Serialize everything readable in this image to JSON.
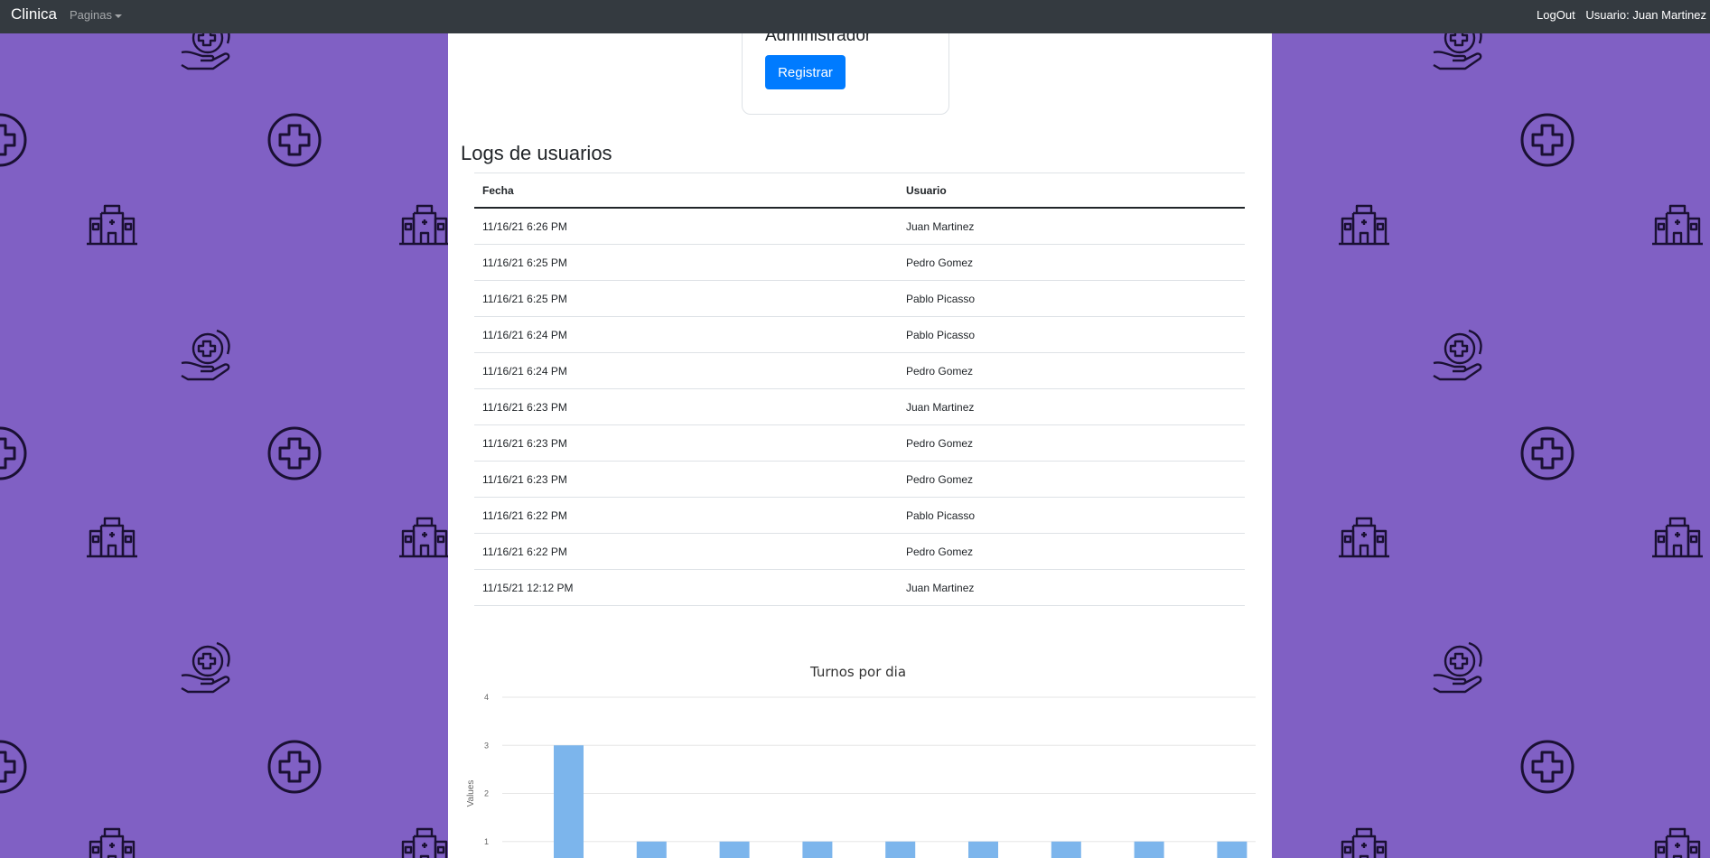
{
  "navbar": {
    "brand": "Clinica",
    "pages_menu": "Paginas",
    "logout": "LogOut",
    "user_label": "Usuario: Juan Martinez"
  },
  "admin_card": {
    "title": "Administrador",
    "register_button": "Registrar"
  },
  "logs": {
    "title": "Logs de usuarios",
    "columns": [
      "Fecha",
      "Usuario"
    ],
    "rows": [
      [
        "11/16/21 6:26 PM",
        "Juan Martinez"
      ],
      [
        "11/16/21 6:25 PM",
        "Pedro Gomez"
      ],
      [
        "11/16/21 6:25 PM",
        "Pablo Picasso"
      ],
      [
        "11/16/21 6:24 PM",
        "Pablo Picasso"
      ],
      [
        "11/16/21 6:24 PM",
        "Pedro Gomez"
      ],
      [
        "11/16/21 6:23 PM",
        "Juan Martinez"
      ],
      [
        "11/16/21 6:23 PM",
        "Pedro Gomez"
      ],
      [
        "11/16/21 6:23 PM",
        "Pedro Gomez"
      ],
      [
        "11/16/21 6:22 PM",
        "Pablo Picasso"
      ],
      [
        "11/16/21 6:22 PM",
        "Pedro Gomez"
      ],
      [
        "11/15/21 12:12 PM",
        "Juan Martinez"
      ]
    ]
  },
  "colors": {
    "page_background": "#8060c4",
    "navbar": "#343a40",
    "primary_button": "#007bff",
    "bar": "#7cb5ec"
  },
  "background_icons": [
    "hand-care-icon",
    "plus-circle-icon",
    "hospital-icon"
  ],
  "chart_data": {
    "type": "bar",
    "title": "Turnos por dia",
    "xlabel": "",
    "ylabel": "Values",
    "ylim": [
      0,
      4
    ],
    "yticks": [
      0,
      1,
      2,
      3,
      4
    ],
    "values": [
      3,
      1,
      1,
      1,
      1,
      1,
      1,
      1,
      1
    ],
    "grid": true,
    "legend": "none"
  }
}
